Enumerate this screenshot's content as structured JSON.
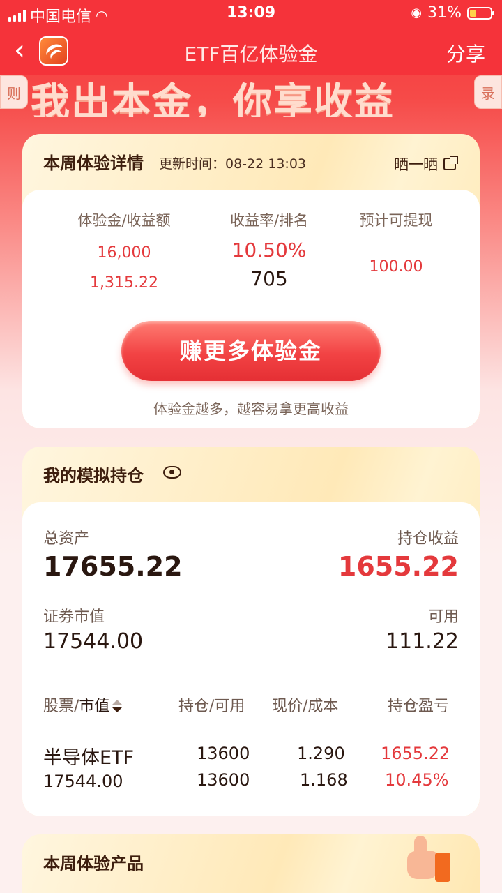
{
  "status_bar": {
    "carrier": "中国电信",
    "time": "13:09",
    "battery": "31%"
  },
  "nav": {
    "title": "ETF百亿体验金",
    "share": "分享"
  },
  "banner": {
    "text": "我出本金，你享收益",
    "left_tab": "则",
    "right_tab": "录"
  },
  "weekly_detail": {
    "title": "本周体验详情",
    "update_time": "更新时间：08-22 13:03",
    "share_label": "晒一晒",
    "columns": [
      {
        "label": "体验金/收益额",
        "v1": "16,000",
        "v2": "1,315.22"
      },
      {
        "label": "收益率/排名",
        "v1": "10.50%",
        "v2": "705"
      },
      {
        "label": "预计可提现",
        "v1": "100.00"
      }
    ],
    "earn_button": "赚更多体验金",
    "earn_tip": "体验金越多，越容易拿更高收益"
  },
  "positions": {
    "title": "我的模拟持仓",
    "total_assets_label": "总资产",
    "total_assets": "17655.22",
    "profit_label": "持仓收益",
    "profit": "1655.22",
    "market_value_label": "证券市值",
    "market_value": "17544.00",
    "available_label": "可用",
    "available": "111.22",
    "headers": {
      "stock": "股票/",
      "stock_sort": "市值",
      "hold": "持仓/可用",
      "price": "现价/成本",
      "pnl": "持仓盈亏"
    },
    "rows": [
      {
        "name": "半导体ETF",
        "value": "17544.00",
        "hold": "13600",
        "avail": "13600",
        "price": "1.290",
        "cost": "1.168",
        "pnl": "1655.22",
        "pnl_pct": "10.45%"
      }
    ]
  },
  "products": {
    "title": "本周体验产品"
  },
  "colors": {
    "brand_red": "#f5333a",
    "profit_red": "#e4393c"
  }
}
